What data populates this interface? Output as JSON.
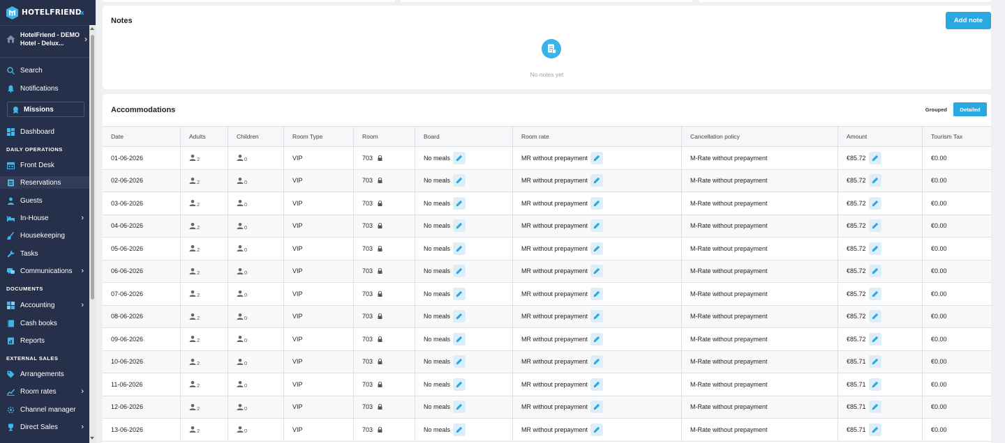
{
  "brand": {
    "name": "HOTELFRIEND",
    "accent": "#2ba8e0",
    "sidebar_bg": "#27304a"
  },
  "hotel": {
    "name": "HotelFriend - DEMO Hotel - Delux..."
  },
  "nav": {
    "search": "Search",
    "notifications": "Notifications",
    "missions": "Missions",
    "dashboard": "Dashboard",
    "daily_operations": "DAILY OPERATIONS",
    "front_desk": "Front Desk",
    "reservations": "Reservations",
    "guests": "Guests",
    "in_house": "In-House",
    "housekeeping": "Housekeeping",
    "tasks": "Tasks",
    "communications": "Communications",
    "documents": "DOCUMENTS",
    "accounting": "Accounting",
    "cash_books": "Cash books",
    "reports": "Reports",
    "external_sales": "EXTERNAL SALES",
    "arrangements": "Arrangements",
    "room_rates": "Room rates",
    "channel_manager": "Channel manager",
    "direct_sales": "Direct Sales"
  },
  "notes": {
    "title": "Notes",
    "add_label": "Add note",
    "empty_text": "No notes yet"
  },
  "accommodations": {
    "title": "Accommodations",
    "view_grouped": "Grouped",
    "view_detailed": "Detailed",
    "columns": [
      "Date",
      "Adults",
      "Children",
      "Room Type",
      "Room",
      "Board",
      "Room rate",
      "Cancellation policy",
      "Amount",
      "Tourism Tax"
    ],
    "rows": [
      {
        "date": "01-06-2026",
        "adults": "2",
        "children": "0",
        "room_type": "VIP",
        "room": "703",
        "board": "No meals",
        "rate": "MR without prepayment",
        "policy": "M-Rate without prepayment",
        "amount": "€85.72",
        "tax": "€0.00"
      },
      {
        "date": "02-06-2026",
        "adults": "2",
        "children": "0",
        "room_type": "VIP",
        "room": "703",
        "board": "No meals",
        "rate": "MR without prepayment",
        "policy": "M-Rate without prepayment",
        "amount": "€85.72",
        "tax": "€0.00"
      },
      {
        "date": "03-06-2026",
        "adults": "2",
        "children": "0",
        "room_type": "VIP",
        "room": "703",
        "board": "No meals",
        "rate": "MR without prepayment",
        "policy": "M-Rate without prepayment",
        "amount": "€85.72",
        "tax": "€0.00"
      },
      {
        "date": "04-06-2026",
        "adults": "2",
        "children": "0",
        "room_type": "VIP",
        "room": "703",
        "board": "No meals",
        "rate": "MR without prepayment",
        "policy": "M-Rate without prepayment",
        "amount": "€85.72",
        "tax": "€0.00"
      },
      {
        "date": "05-06-2026",
        "adults": "2",
        "children": "0",
        "room_type": "VIP",
        "room": "703",
        "board": "No meals",
        "rate": "MR without prepayment",
        "policy": "M-Rate without prepayment",
        "amount": "€85.72",
        "tax": "€0.00"
      },
      {
        "date": "06-06-2026",
        "adults": "2",
        "children": "0",
        "room_type": "VIP",
        "room": "703",
        "board": "No meals",
        "rate": "MR without prepayment",
        "policy": "M-Rate without prepayment",
        "amount": "€85.72",
        "tax": "€0.00"
      },
      {
        "date": "07-06-2026",
        "adults": "2",
        "children": "0",
        "room_type": "VIP",
        "room": "703",
        "board": "No meals",
        "rate": "MR without prepayment",
        "policy": "M-Rate without prepayment",
        "amount": "€85.72",
        "tax": "€0.00"
      },
      {
        "date": "08-06-2026",
        "adults": "2",
        "children": "0",
        "room_type": "VIP",
        "room": "703",
        "board": "No meals",
        "rate": "MR without prepayment",
        "policy": "M-Rate without prepayment",
        "amount": "€85.72",
        "tax": "€0.00"
      },
      {
        "date": "09-06-2026",
        "adults": "2",
        "children": "0",
        "room_type": "VIP",
        "room": "703",
        "board": "No meals",
        "rate": "MR without prepayment",
        "policy": "M-Rate without prepayment",
        "amount": "€85.72",
        "tax": "€0.00"
      },
      {
        "date": "10-06-2026",
        "adults": "2",
        "children": "0",
        "room_type": "VIP",
        "room": "703",
        "board": "No meals",
        "rate": "MR without prepayment",
        "policy": "M-Rate without prepayment",
        "amount": "€85.71",
        "tax": "€0.00"
      },
      {
        "date": "11-06-2026",
        "adults": "2",
        "children": "0",
        "room_type": "VIP",
        "room": "703",
        "board": "No meals",
        "rate": "MR without prepayment",
        "policy": "M-Rate without prepayment",
        "amount": "€85.71",
        "tax": "€0.00"
      },
      {
        "date": "12-06-2026",
        "adults": "2",
        "children": "0",
        "room_type": "VIP",
        "room": "703",
        "board": "No meals",
        "rate": "MR without prepayment",
        "policy": "M-Rate without prepayment",
        "amount": "€85.71",
        "tax": "€0.00"
      },
      {
        "date": "13-06-2026",
        "adults": "2",
        "children": "0",
        "room_type": "VIP",
        "room": "703",
        "board": "No meals",
        "rate": "MR without prepayment",
        "policy": "M-Rate without prepayment",
        "amount": "€85.71",
        "tax": "€0.00"
      }
    ]
  }
}
